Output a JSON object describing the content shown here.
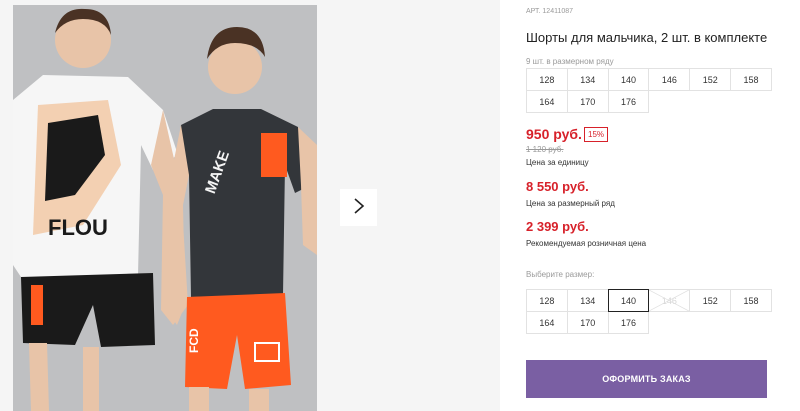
{
  "gallery": {
    "next_icon": "chevron-right-icon",
    "photo_lettering": {
      "left_shirt": "FLOU",
      "right_shirt": "MAKE",
      "shorts_a": "FCD",
      "shorts_b": "FCD"
    }
  },
  "product": {
    "sku": "АРТ. 12411087",
    "title": "Шорты для мальчика, 2 шт. в комплекте",
    "row_note": "9 шт. в размерном ряду"
  },
  "size_row": [
    "128",
    "134",
    "140",
    "146",
    "152",
    "158",
    "164",
    "170",
    "176"
  ],
  "pricing": {
    "unit_price": "950 руб.",
    "discount_badge": "15%",
    "old_price": "1 120 руб.",
    "unit_label": "Цена за единицу",
    "row_price": "8 550 руб.",
    "row_label": "Цена за размерный ряд",
    "retail_price": "2 399 руб.",
    "retail_label": "Рекомендуемая розничная цена"
  },
  "size_picker": {
    "label": "Выберите размер:",
    "options": [
      "128",
      "134",
      "140",
      "146",
      "152",
      "158",
      "164",
      "170",
      "176"
    ],
    "selected": "140",
    "unavailable": "146"
  },
  "order_button": {
    "label": "ОФОРМИТЬ ЗАКАЗ"
  },
  "colors": {
    "accent_red": "#d7212a",
    "button_purple": "#7a5fa3",
    "shorts_orange": "#ff5a1f"
  }
}
